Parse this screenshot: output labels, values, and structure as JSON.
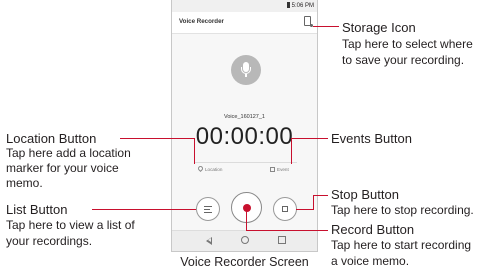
{
  "phone": {
    "status_time": "5:06 PM",
    "app_title": "Voice Recorder",
    "file_name": "Voice_160127_1",
    "timer": "00:00:00",
    "location_label": "Location",
    "event_label": "Event"
  },
  "callouts": {
    "storage": {
      "title": "Storage Icon",
      "desc_line1": "Tap here to select where",
      "desc_line2": "to save your recording."
    },
    "location": {
      "title": "Location Button",
      "desc_line1": "Tap here add a location",
      "desc_line2": "marker for your voice",
      "desc_line3": "memo."
    },
    "events": {
      "title": "Events Button"
    },
    "list": {
      "title": "List Button",
      "desc_line1": "Tap here to view a list of",
      "desc_line2": "your recordings."
    },
    "stop": {
      "title": "Stop Button",
      "desc_line1": "Tap here to stop recording."
    },
    "record": {
      "title": "Record Button",
      "desc_line1": "Tap here to start recording",
      "desc_line2": "a voice memo."
    }
  },
  "caption": "Voice Recorder Screen",
  "colors": {
    "callout_line": "#c8102e",
    "record_dot": "#c8102e",
    "mic_circle": "#b8b8b8"
  }
}
